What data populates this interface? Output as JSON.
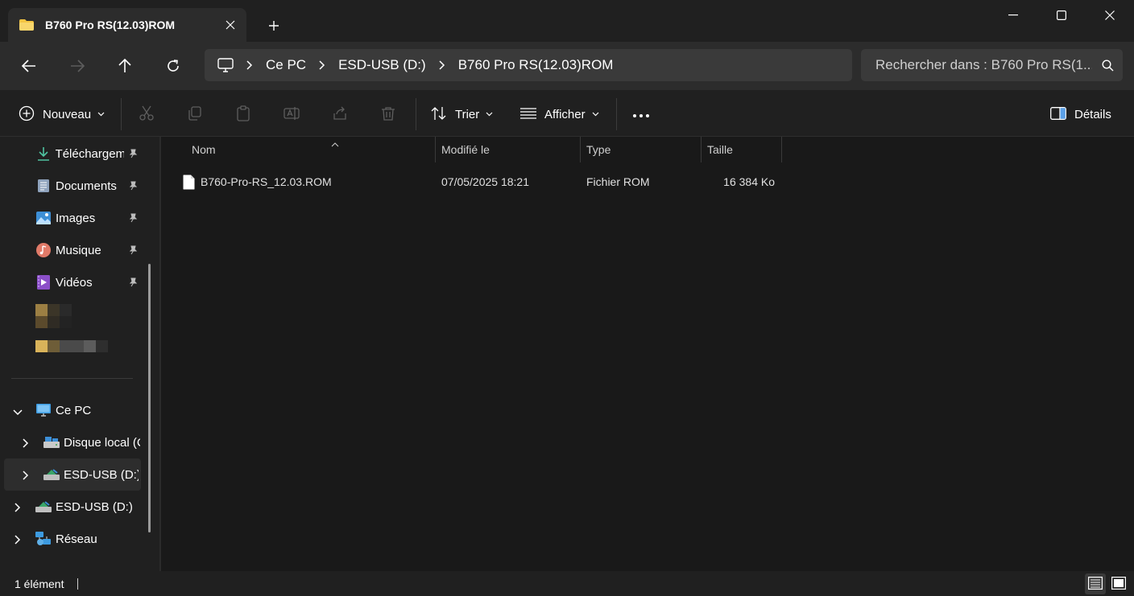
{
  "window": {
    "tab_title": "B760 Pro RS(12.03)ROM",
    "controls": [
      "minimize",
      "maximize",
      "close"
    ]
  },
  "nav": {
    "breadcrumb": [
      "Ce PC",
      "ESD-USB (D:)",
      "B760 Pro RS(12.03)ROM"
    ],
    "search_placeholder": "Rechercher dans : B760 Pro RS(1..."
  },
  "command_bar": {
    "new_label": "Nouveau",
    "sort_label": "Trier",
    "view_label": "Afficher",
    "details_label": "Détails"
  },
  "sidebar": {
    "quick_access": [
      {
        "label": "Téléchargem",
        "icon": "download-icon",
        "pinned": true
      },
      {
        "label": "Documents",
        "icon": "document-icon",
        "pinned": true
      },
      {
        "label": "Images",
        "icon": "image-icon",
        "pinned": true
      },
      {
        "label": "Musique",
        "icon": "music-icon",
        "pinned": true
      },
      {
        "label": "Vidéos",
        "icon": "video-icon",
        "pinned": true
      }
    ],
    "tree": [
      {
        "label": "Ce PC",
        "icon": "pc-icon",
        "expanded": true
      },
      {
        "label": "Disque local (C",
        "icon": "drive-icon"
      },
      {
        "label": "ESD-USB (D:)",
        "icon": "usb-drive-icon",
        "selected": true
      },
      {
        "label": "ESD-USB (D:)",
        "icon": "usb-drive-icon"
      },
      {
        "label": "Réseau",
        "icon": "network-icon"
      }
    ]
  },
  "file_list": {
    "columns": [
      "Nom",
      "Modifié le",
      "Type",
      "Taille"
    ],
    "rows": [
      {
        "name": "B760-Pro-RS_12.03.ROM",
        "modified": "07/05/2025 18:21",
        "type": "Fichier ROM",
        "size": "16 384 Ko"
      }
    ]
  },
  "status": {
    "count": "1 élément"
  },
  "colors": {
    "background": "#202020",
    "list_background": "#191919",
    "address_bar": "#3a3a3a",
    "folder_yellow": "#f4c542"
  }
}
